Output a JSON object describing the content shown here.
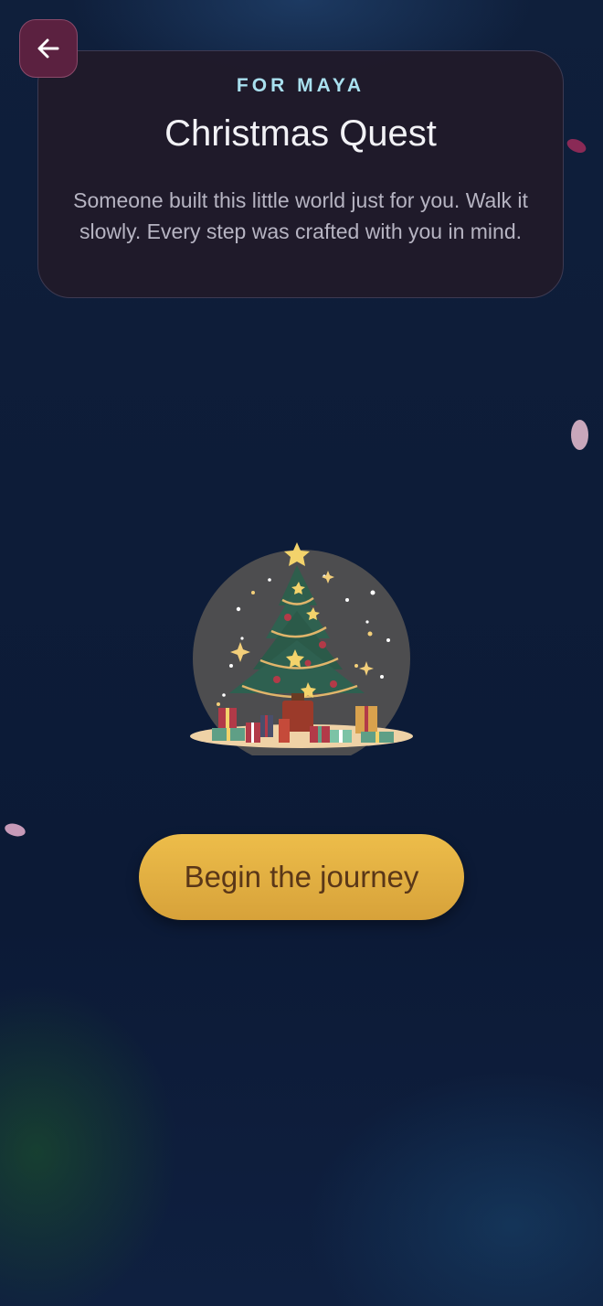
{
  "header": {
    "back_icon": "arrow-left-icon",
    "eyebrow": "FOR MAYA",
    "title": "Christmas Quest",
    "description": "Someone built this little world just for you. Walk it slowly. Every step was crafted with you in mind."
  },
  "illustration": {
    "name": "christmas-tree-globe"
  },
  "actions": {
    "begin_label": "Begin the journey"
  },
  "colors": {
    "background": "#0d1c38",
    "card": "#201a2a",
    "eyebrow": "#a9e0ef",
    "button": "#e4b043",
    "button_text": "#5a3718",
    "back_button": "#5b2140"
  }
}
